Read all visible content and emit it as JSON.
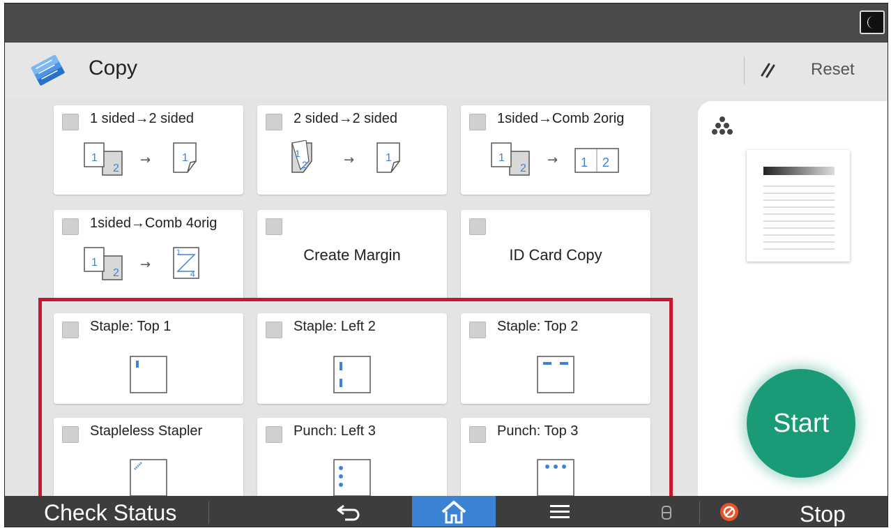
{
  "app": {
    "title": "Copy"
  },
  "header": {
    "reset_label": "Reset"
  },
  "tiles": [
    {
      "label": "1 sided→2 sided",
      "icon": "duplex-1to2-icon"
    },
    {
      "label": "2 sided→2 sided",
      "icon": "duplex-2to2-icon"
    },
    {
      "label": "1sided→Comb 2orig",
      "icon": "combine-2-icon",
      "nums": [
        "1",
        "2"
      ]
    },
    {
      "label": "1sided→Comb 4orig",
      "icon": "combine-4-icon"
    },
    {
      "label": "Create Margin",
      "icon": ""
    },
    {
      "label": "ID Card Copy",
      "icon": ""
    },
    {
      "label": "Staple: Top 1",
      "icon": "staple-top1-icon"
    },
    {
      "label": "Staple: Left 2",
      "icon": "staple-left2-icon"
    },
    {
      "label": "Staple: Top 2",
      "icon": "staple-top2-icon"
    },
    {
      "label": "Stapleless Stapler",
      "icon": "stapleless-icon"
    },
    {
      "label": "Punch: Left 3",
      "icon": "punch-left3-icon"
    },
    {
      "label": "Punch: Top 3",
      "icon": "punch-top3-icon"
    }
  ],
  "right_panel": {
    "start_label": "Start"
  },
  "bottom_bar": {
    "check_status_label": "Check Status",
    "stop_label": "Stop"
  },
  "colors": {
    "accent_blue": "#3c83d6",
    "start_green": "#1b9a78",
    "highlight_red": "#c61830",
    "stop_orange": "#e8542a"
  }
}
